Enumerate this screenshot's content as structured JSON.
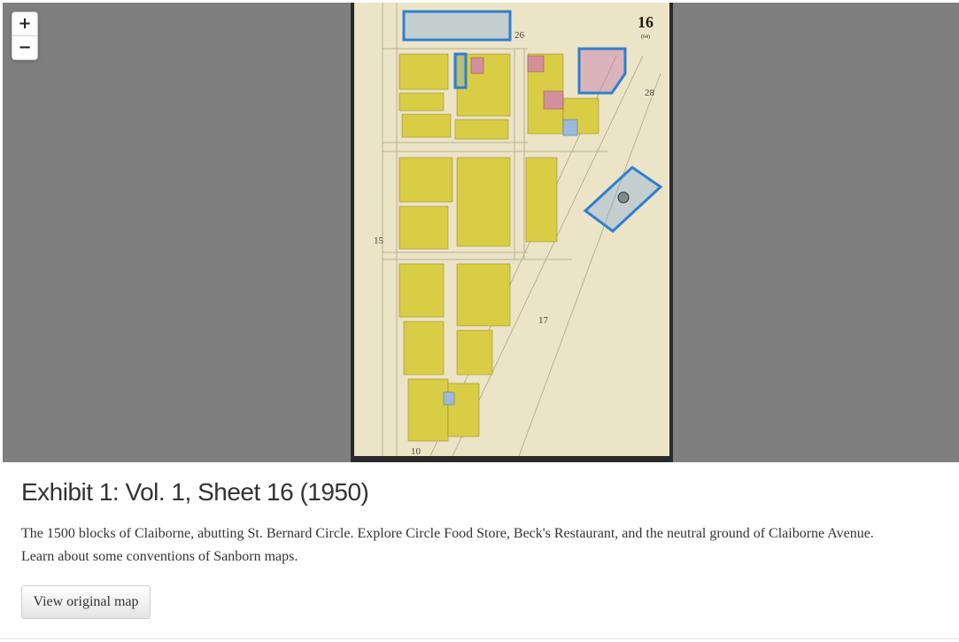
{
  "map": {
    "zoom_in_label": "+",
    "zoom_out_label": "−",
    "sheet_number": "16",
    "sheet_sub_label": "(64)",
    "block_numbers": [
      "26",
      "28",
      "15",
      "17",
      "10"
    ],
    "overlay_color": "#2f7fd0",
    "building_color": "#d9cd45",
    "paper_color": "#ece4c6"
  },
  "exhibit": {
    "title": "Exhibit 1: Vol. 1, Sheet 16 (1950)",
    "description_line1": "The 1500 blocks of Claiborne, abutting St. Bernard Circle. Explore Circle Food Store, Beck's Restaurant, and the neutral ground of Claiborne Avenue.",
    "description_line2": "Learn about some conventions of Sanborn maps.",
    "button_label": "View original map"
  }
}
